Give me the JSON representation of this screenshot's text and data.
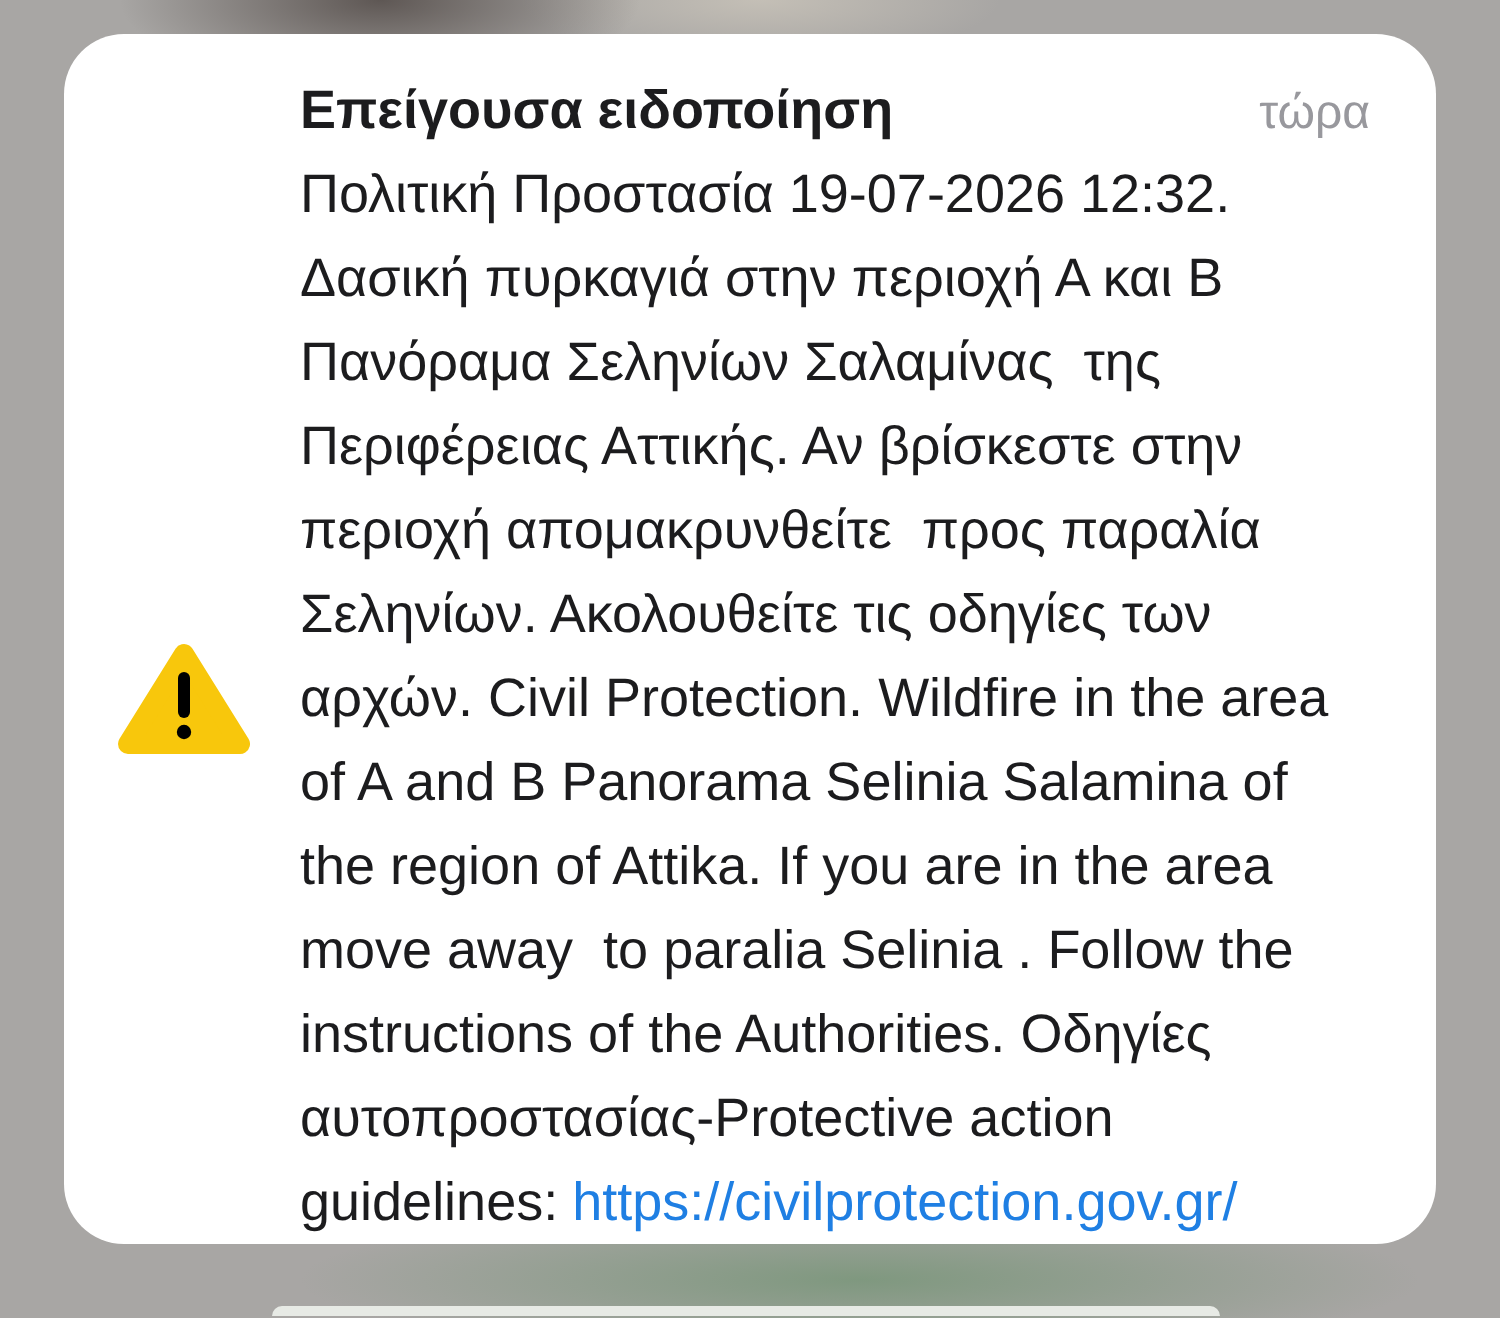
{
  "notification": {
    "title": "Επείγουσα ειδοποίηση",
    "time": "τώρα",
    "body_lines": [
      "Πολιτική Προστασία 19-07-2026 12:32.",
      "Δασική πυρκαγιά στην περιοχή Α και Β",
      "Πανόραμα Σεληνίων Σαλαμίνας  της",
      "Περιφέρειας Αττικής. Αν βρίσκεστε στην",
      "περιοχή απομακρυνθείτε  προς παραλία",
      "Σεληνίων. Ακολουθείτε τις οδηγίες των",
      "αρχών. Civil Protection. Wildfire in the area",
      "of A and B Panorama Selinia Salamina of",
      "the region of Attika. If you are in the area",
      "move away  to paralia Selinia . Follow the",
      "instructions of the Authorities. Οδηγίες",
      "αυτοπροστασίας-Protective action",
      "guidelines:"
    ],
    "link": "https://civilprotection.gov.gr/"
  }
}
